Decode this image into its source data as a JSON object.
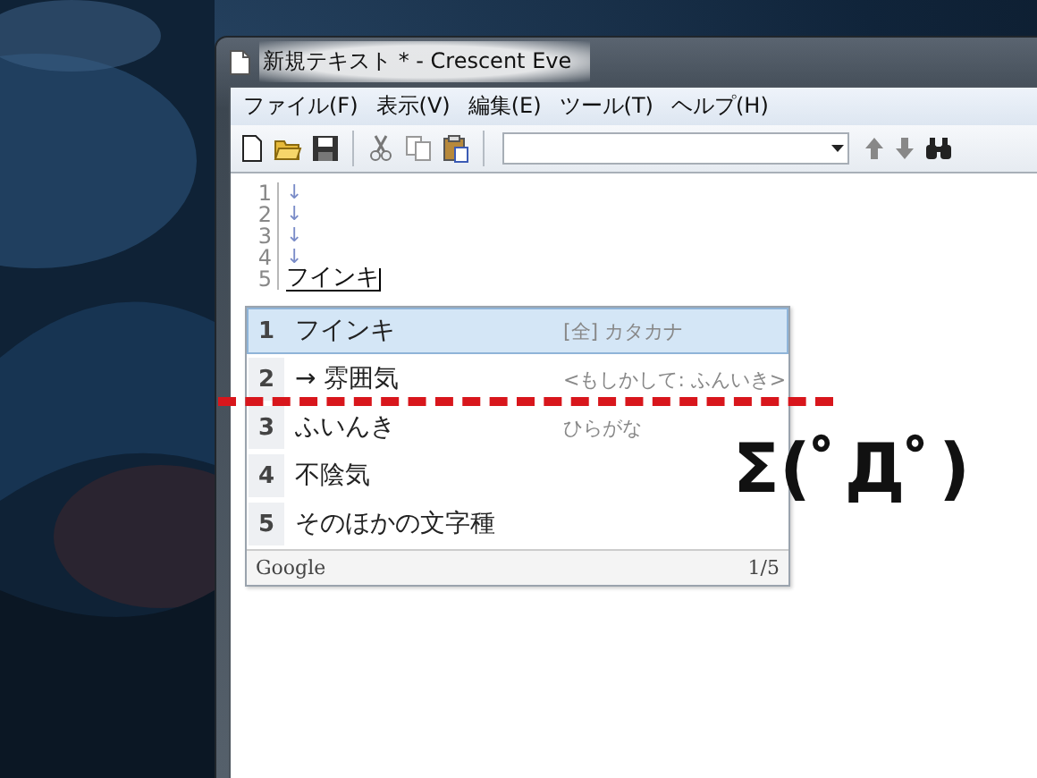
{
  "window": {
    "title": "新規テキスト * - Crescent Eve"
  },
  "menu": [
    "ファイル(F)",
    "表示(V)",
    "編集(E)",
    "ツール(T)",
    "ヘルプ(H)"
  ],
  "editor": {
    "lines": [
      {
        "number": "1",
        "eol": "↓"
      },
      {
        "number": "2",
        "eol": "↓"
      },
      {
        "number": "3",
        "eol": "↓"
      },
      {
        "number": "4",
        "eol": "↓"
      },
      {
        "number": "5",
        "text": "フインキ"
      }
    ]
  },
  "candidates": {
    "items": [
      {
        "number": "1",
        "text": "フインキ",
        "note": "[全] カタカナ",
        "selected": true
      },
      {
        "number": "2",
        "text": "→ 雰囲気",
        "note": "<もしかして: ふんいき>",
        "selected": false
      },
      {
        "number": "3",
        "text": "ふいんき",
        "note": "ひらがな",
        "selected": false
      },
      {
        "number": "4",
        "text": "不陰気",
        "selected": false
      },
      {
        "number": "5",
        "text": "そのほかの文字種",
        "selected": false
      }
    ],
    "footer": {
      "source": "Google",
      "page": "1/5"
    }
  },
  "annotation": {
    "kaomoji": "Σ(ﾟДﾟ)"
  }
}
